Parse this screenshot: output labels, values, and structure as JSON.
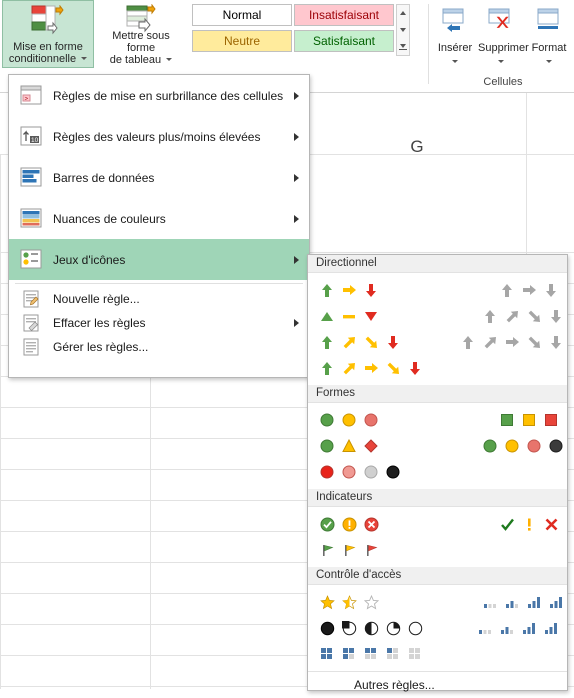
{
  "ribbon": {
    "conditional_formatting": {
      "label_line1": "Mise en forme",
      "label_line2": "conditionnelle",
      "icon": "conditional-formatting-icon"
    },
    "format_as_table": {
      "label_line1": "Mettre sous forme",
      "label_line2": "de tableau",
      "icon": "format-as-table-icon"
    },
    "styles_gallery": {
      "cells": [
        "Normal",
        "Insatisfaisant",
        "Neutre",
        "Satisfaisant"
      ],
      "scroll_up": "scroll-up-icon",
      "scroll_down": "scroll-down-icon",
      "more": "more-icon"
    },
    "cells_group": {
      "label": "Cellules",
      "buttons": [
        {
          "label": "Insérer",
          "icon": "insert-cells-icon"
        },
        {
          "label": "Supprimer",
          "icon": "delete-cells-icon"
        },
        {
          "label": "Format",
          "icon": "format-cells-icon"
        }
      ]
    }
  },
  "sheet": {
    "column_header": "G"
  },
  "menu": {
    "items": [
      {
        "label": "Règles de mise en surbrillance des cellules",
        "icon": "highlight-cells-rules-icon",
        "submenu": true
      },
      {
        "label": "Règles des valeurs plus/moins élevées",
        "icon": "top-bottom-rules-icon",
        "submenu": true
      },
      {
        "label": "Barres de données",
        "icon": "data-bars-icon",
        "submenu": true
      },
      {
        "label": "Nuances de couleurs",
        "icon": "color-scales-icon",
        "submenu": true
      },
      {
        "label": "Jeux d'icônes",
        "icon": "icon-sets-icon",
        "submenu": true,
        "selected": true
      }
    ],
    "commands": [
      {
        "label": "Nouvelle règle...",
        "icon": "new-rule-icon"
      },
      {
        "label": "Effacer les règles",
        "icon": "clear-rules-icon",
        "submenu": true
      },
      {
        "label": "Gérer les règles...",
        "icon": "manage-rules-icon"
      }
    ]
  },
  "iconset_flyout": {
    "sections": [
      {
        "title": "Directionnel",
        "rows": [
          {
            "left": [
              "arrow-up-green",
              "arrow-right-yellow",
              "arrow-down-red"
            ],
            "right": [
              "arrow-up-gray",
              "arrow-right-gray",
              "arrow-down-gray"
            ]
          },
          {
            "left": [
              "triangle-up-green",
              "dash-yellow",
              "triangle-down-red"
            ],
            "right": [
              "arrow-up-gray",
              "arrow-upright-gray",
              "arrow-downright-gray",
              "arrow-down-gray"
            ]
          },
          {
            "left": [
              "arrow-up-green",
              "arrow-upright-yellow",
              "arrow-downright-yellow",
              "arrow-down-red"
            ],
            "right": [
              "arrow-up-gray",
              "arrow-upright-gray",
              "arrow-right-gray",
              "arrow-downright-gray",
              "arrow-down-gray"
            ]
          },
          {
            "left": [
              "arrow-up-green",
              "arrow-upright-yellow",
              "arrow-right-yellow",
              "arrow-downright-yellow",
              "arrow-down-red"
            ],
            "right": []
          }
        ]
      },
      {
        "title": "Formes",
        "rows": [
          {
            "left": [
              "circle-green",
              "circle-yellow",
              "circle-red"
            ],
            "right": [
              "square-green",
              "square-yellow",
              "square-red"
            ]
          },
          {
            "left": [
              "circle-green",
              "triangle-yellow",
              "diamond-red"
            ],
            "right": [
              "circle-green",
              "circle-yellow",
              "circle-pink",
              "circle-black"
            ]
          },
          {
            "left": [
              "circle-red",
              "circle-lightred",
              "circle-gray",
              "circle-black"
            ],
            "right": []
          }
        ]
      },
      {
        "title": "Indicateurs",
        "rows": [
          {
            "left": [
              "check-circle-green",
              "exclamation-circle-yellow",
              "cross-circle-red"
            ],
            "right": [
              "check-green",
              "exclamation-yellow",
              "cross-red"
            ]
          },
          {
            "left": [
              "flag-green",
              "flag-yellow",
              "flag-red"
            ],
            "right": []
          }
        ]
      },
      {
        "title": "Contrôle d'accès",
        "rows": [
          {
            "left": [
              "star-full-yellow",
              "star-half-yellow",
              "star-empty"
            ],
            "right": [
              "bars-1",
              "bars-2",
              "bars-3",
              "bars-4"
            ]
          },
          {
            "left": [
              "pie-0",
              "pie-25",
              "pie-50",
              "pie-75",
              "pie-100"
            ],
            "right": [
              "signal-1",
              "signal-2",
              "signal-3",
              "signal-4"
            ]
          },
          {
            "left": [
              "boxes-4",
              "boxes-3",
              "boxes-2",
              "boxes-1",
              "boxes-0"
            ],
            "right": []
          }
        ]
      }
    ],
    "footer": {
      "label": "Autres règles...",
      "icon": "other-rules-icon"
    }
  },
  "colors": {
    "green": "#57a04a",
    "yellow": "#ffc000",
    "red": "#e02b20",
    "gray": "#a6a6a6",
    "selection": "#9fd5b7",
    "ribbon_selected": "#c7e5d3"
  }
}
